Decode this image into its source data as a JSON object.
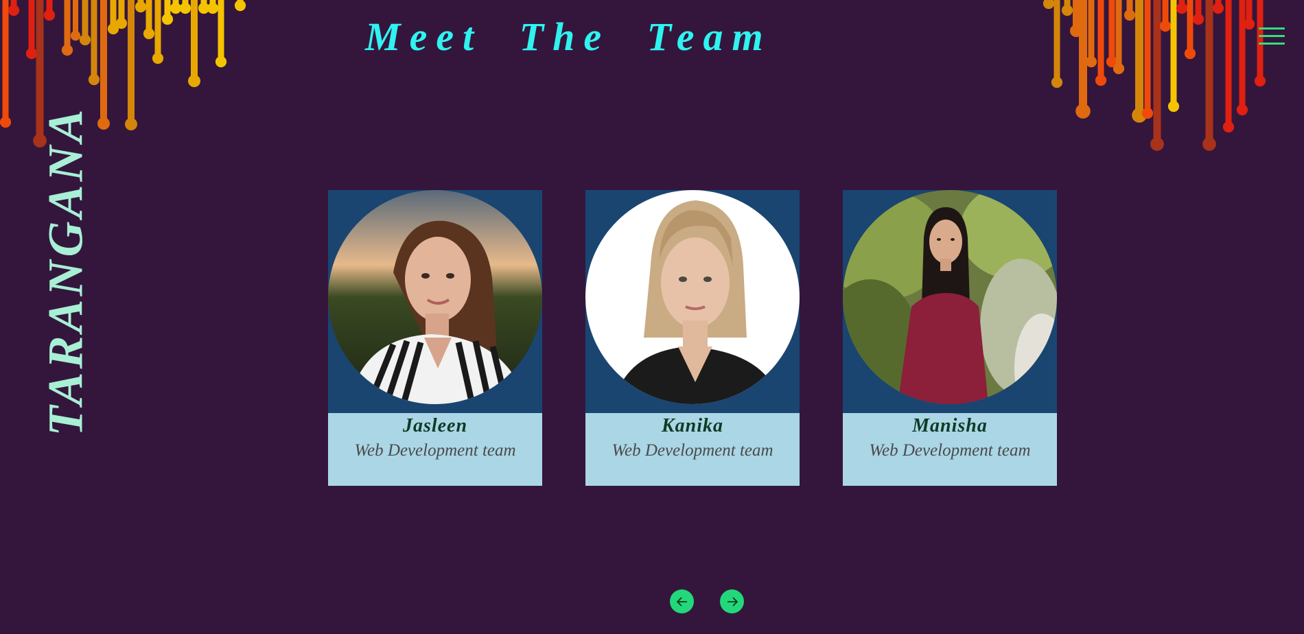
{
  "brand": {
    "name": "TARANGANA"
  },
  "header": {
    "title": "Meet The Team"
  },
  "menu": {
    "icon": "hamburger-menu-icon"
  },
  "team": [
    {
      "name": "Jasleen",
      "team": "Web Development team",
      "photo": "woman-striped-shirt-portrait"
    },
    {
      "name": "Kanika",
      "team": "Web Development team",
      "photo": "woman-blonde-bob-portrait"
    },
    {
      "name": "Manisha",
      "team": "Web Development team",
      "photo": "woman-red-dress-portrait"
    }
  ],
  "navigation": {
    "previous_icon": "arrow-left-icon",
    "next_icon": "arrow-right-icon"
  },
  "colors": {
    "background": "#34163c",
    "title": "#2ff3f0",
    "brand": "#a8efd6",
    "card_top": "#1a4570",
    "card_bottom": "#aad6e6",
    "member_name": "#0f3a25",
    "accent_green": "#22d87a"
  }
}
